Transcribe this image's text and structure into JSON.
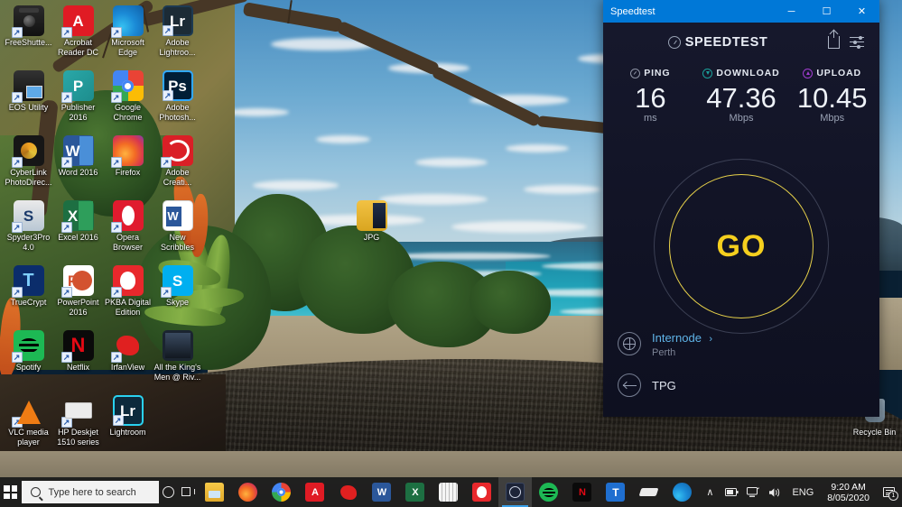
{
  "desktop": {
    "icons": [
      {
        "label": "FreeShutte...",
        "art": "g-camera",
        "glyph": "",
        "shortcut": true
      },
      {
        "label": "Acrobat Reader DC",
        "art": "g-acrobat",
        "glyph": "A",
        "shortcut": true
      },
      {
        "label": "Microsoft Edge",
        "art": "g-edge",
        "glyph": "",
        "shortcut": true
      },
      {
        "label": "Adobe Lightroo...",
        "art": "g-lr",
        "glyph": "Lr",
        "shortcut": true
      },
      {
        "label": "EOS Utility",
        "art": "g-eos",
        "glyph": "",
        "shortcut": true
      },
      {
        "label": "Publisher 2016",
        "art": "g-pub",
        "glyph": "P",
        "shortcut": true
      },
      {
        "label": "Google Chrome",
        "art": "g-chrome",
        "glyph": "",
        "shortcut": true
      },
      {
        "label": "Adobe Photosh...",
        "art": "g-ps",
        "glyph": "Ps",
        "shortcut": true
      },
      {
        "label": "CyberLink PhotoDirec...",
        "art": "g-cyber",
        "glyph": "",
        "shortcut": true
      },
      {
        "label": "Word 2016",
        "art": "g-word",
        "glyph": "W",
        "shortcut": true
      },
      {
        "label": "Firefox",
        "art": "g-firefox",
        "glyph": "",
        "shortcut": true
      },
      {
        "label": "Adobe Creati...",
        "art": "g-adobecc",
        "glyph": "",
        "shortcut": true
      },
      {
        "label": "Spyder3Pro 4.0",
        "art": "g-spyder",
        "glyph": "S",
        "shortcut": true
      },
      {
        "label": "Excel 2016",
        "art": "g-excel",
        "glyph": "X",
        "shortcut": true
      },
      {
        "label": "Opera Browser",
        "art": "g-opera",
        "glyph": "",
        "shortcut": true
      },
      {
        "label": "New Scribbles",
        "art": "g-docx",
        "glyph": "W",
        "shortcut": false
      },
      {
        "label": "TrueCrypt",
        "art": "g-truecry",
        "glyph": "",
        "shortcut": true
      },
      {
        "label": "PowerPoint 2016",
        "art": "g-ppt",
        "glyph": "P",
        "shortcut": true
      },
      {
        "label": "PKBA Digital Edition",
        "art": "g-pkba",
        "glyph": "",
        "shortcut": true
      },
      {
        "label": "Skype",
        "art": "g-skype",
        "glyph": "S",
        "shortcut": true
      },
      {
        "label": "Spotify",
        "art": "g-spotify",
        "glyph": "",
        "shortcut": true
      },
      {
        "label": "Netflix",
        "art": "g-netflix",
        "glyph": "N",
        "shortcut": true
      },
      {
        "label": "IrfanView",
        "art": "g-irfan",
        "glyph": "",
        "shortcut": true
      },
      {
        "label": "All the King's Men @ Riv...",
        "art": "g-allking",
        "glyph": "",
        "shortcut": false
      },
      {
        "label": "VLC media player",
        "art": "g-vlc",
        "glyph": "",
        "shortcut": true
      },
      {
        "label": "HP Deskjet 1510 series",
        "art": "g-hp",
        "glyph": "",
        "shortcut": true
      },
      {
        "label": "Lightroom",
        "art": "g-lr2",
        "glyph": "Lr",
        "shortcut": true
      }
    ],
    "jpg_folder": {
      "label": "JPG",
      "art": "g-folder"
    },
    "recycle_bin": {
      "label": "Recycle Bin",
      "art": "g-recycle"
    }
  },
  "speedtest": {
    "window_title": "Speedtest",
    "window_buttons": {
      "minimize": "─",
      "maximize": "☐",
      "close": "✕"
    },
    "brand": "SPEEDTEST",
    "brand_icon": "speedometer-icon",
    "header_icons": {
      "share": "share-icon",
      "settings": "sliders-icon"
    },
    "metrics": [
      {
        "key": "ping",
        "label": "PING",
        "value": "16",
        "unit": "ms",
        "color": "#8d93a4",
        "icon": "ping-icon"
      },
      {
        "key": "download",
        "label": "DOWNLOAD",
        "value": "47.36",
        "unit": "Mbps",
        "color": "#1aa09a",
        "icon": "download-arrow-icon"
      },
      {
        "key": "upload",
        "label": "UPLOAD",
        "value": "10.45",
        "unit": "Mbps",
        "color": "#a13dcf",
        "icon": "upload-arrow-icon"
      }
    ],
    "go_button": {
      "label": "GO",
      "color": "#f5cf1e"
    },
    "server": {
      "name": "Internode",
      "chevron": "›",
      "location": "Perth",
      "icon": "globe-icon"
    },
    "isp": {
      "name": "TPG",
      "icon": "connection-arrows-icon"
    },
    "accent_titlebar": "#0078d7",
    "background": "#141527"
  },
  "taskbar": {
    "start_label": "Start",
    "search": {
      "placeholder": "Type here to search",
      "icon": "search-icon"
    },
    "cortana": "cortana-icon",
    "task_view": "task-view-icon",
    "apps": [
      {
        "name": "file-explorer",
        "glyph": "",
        "art": "tb-explorer",
        "active": false
      },
      {
        "name": "firefox",
        "glyph": "",
        "art": "tb-firefox",
        "active": false
      },
      {
        "name": "google-chrome",
        "glyph": "",
        "art": "tb-chrome",
        "active": false
      },
      {
        "name": "acrobat-reader",
        "glyph": "A",
        "art": "tb-acrobat",
        "active": false
      },
      {
        "name": "irfanview",
        "glyph": "",
        "art": "tb-irfan",
        "active": false
      },
      {
        "name": "word",
        "glyph": "W",
        "art": "tb-word",
        "active": false
      },
      {
        "name": "excel",
        "glyph": "X",
        "art": "tb-excel",
        "active": false
      },
      {
        "name": "calculator",
        "glyph": "",
        "art": "tb-calc",
        "active": false
      },
      {
        "name": "pkba-digital-edition",
        "glyph": "",
        "art": "tb-pkba",
        "active": false
      },
      {
        "name": "speedtest",
        "glyph": "",
        "art": "tb-speedtest",
        "active": true
      },
      {
        "name": "spotify",
        "glyph": "",
        "art": "tb-spotify",
        "active": false
      },
      {
        "name": "netflix",
        "glyph": "N",
        "art": "tb-netflix",
        "active": false
      },
      {
        "name": "telstra",
        "glyph": "T",
        "art": "tb-telstra",
        "active": false
      },
      {
        "name": "sketch-app",
        "glyph": "",
        "art": "tb-sketch",
        "active": false
      },
      {
        "name": "microsoft-edge",
        "glyph": "",
        "art": "tb-edge",
        "active": false
      }
    ],
    "tray": {
      "chevron": "∧",
      "battery": "battery-icon",
      "network": "network-icon",
      "volume": "volume-icon",
      "language": "ENG",
      "time": "9:20 AM",
      "date": "8/05/2020",
      "notification_count": "1"
    }
  }
}
